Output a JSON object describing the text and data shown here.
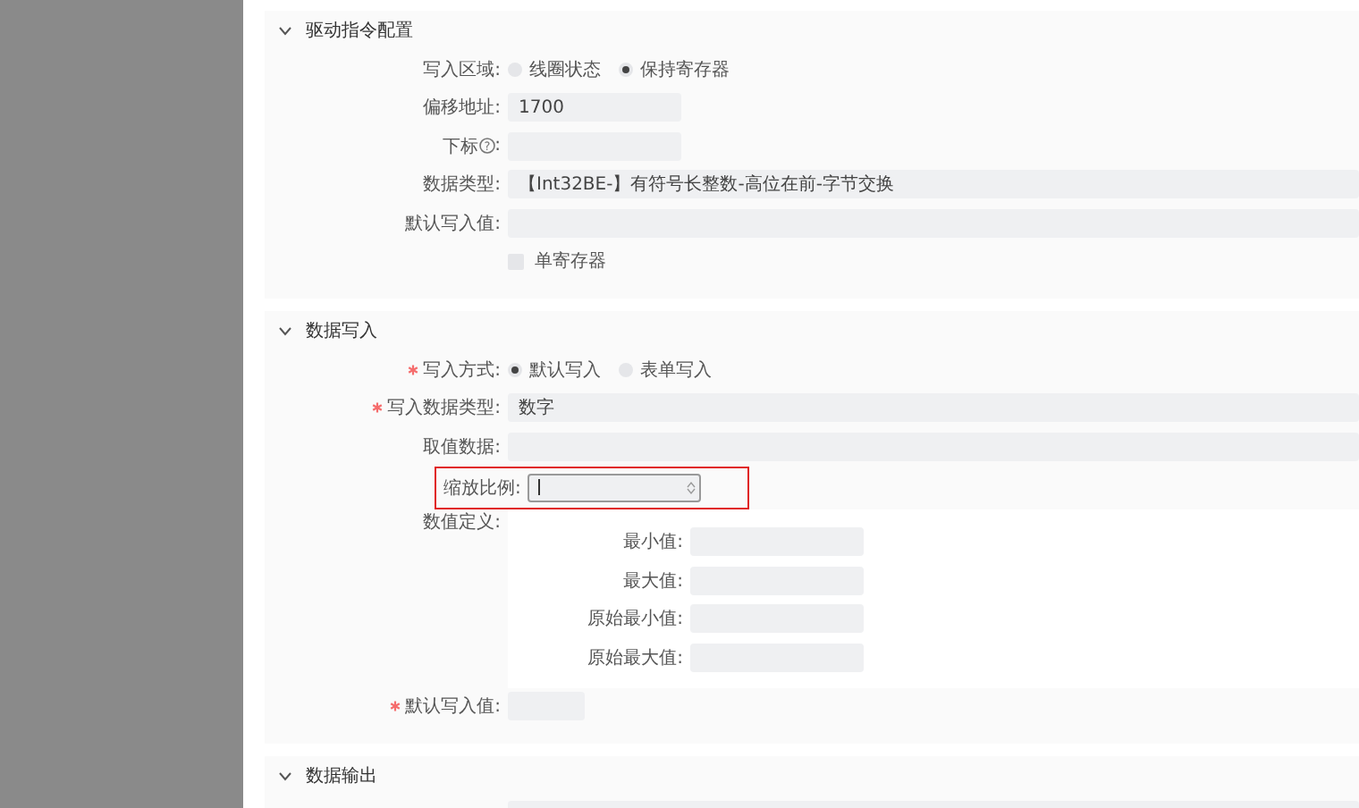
{
  "sections": [
    {
      "title": "驱动指令配置",
      "expanded": true,
      "rows": [
        {
          "kind": "radio",
          "label": "写入区域:",
          "options": [
            {
              "label": "线圈状态",
              "selected": false
            },
            {
              "label": "保持寄存器",
              "selected": true
            }
          ]
        },
        {
          "kind": "short-input",
          "label": "偏移地址:",
          "value": "1700"
        },
        {
          "kind": "short-input",
          "label": "下标",
          "help": "?",
          "label_suffix": ":"
        },
        {
          "kind": "input",
          "label": "数据类型:",
          "value": "【Int32BE-】有符号长整数-高位在前-字节交换"
        },
        {
          "kind": "input",
          "label": "默认写入值:"
        },
        {
          "kind": "checkbox",
          "text": "单寄存器",
          "checked": false
        }
      ]
    },
    {
      "title": "数据写入",
      "expanded": true,
      "rows": [
        {
          "kind": "radio",
          "label": "写入方式:",
          "required": true,
          "options": [
            {
              "label": "默认写入",
              "selected": true
            },
            {
              "label": "表单写入",
              "selected": false
            }
          ]
        },
        {
          "kind": "input",
          "label": "写入数据类型:",
          "required": true,
          "value": "数字"
        },
        {
          "kind": "input",
          "label": "取值数据:"
        },
        {
          "kind": "number",
          "label": "缩放比例:",
          "focused": true,
          "highlighted": true
        },
        {
          "kind": "group",
          "label": "数值定义:",
          "fields": [
            {
              "label": "最小值:"
            },
            {
              "label": "最大值:"
            },
            {
              "label": "原始最小值:"
            },
            {
              "label": "原始最大值:"
            }
          ]
        },
        {
          "kind": "tiny-input",
          "label": "默认写入值:",
          "required": true
        }
      ]
    },
    {
      "title": "数据输出",
      "expanded": true,
      "rows": [
        {
          "kind": "input"
        }
      ]
    }
  ]
}
